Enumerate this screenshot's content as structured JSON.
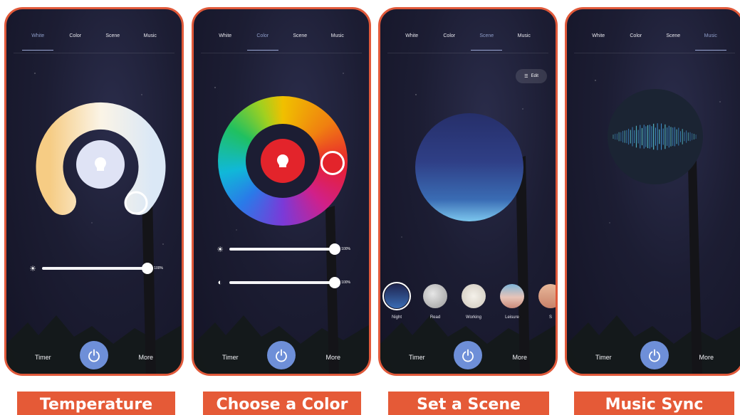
{
  "tabs": [
    "White",
    "Color",
    "Scene",
    "Music"
  ],
  "screens": [
    {
      "active_tab": 0,
      "tab_labels": [
        "White",
        "Color",
        "Scene",
        "Music"
      ],
      "timer": "Timer",
      "more": "More"
    },
    {
      "active_tab": 1,
      "tab_labels": [
        "White",
        "Color",
        "Scene",
        "Music"
      ],
      "timer": "Timer",
      "more": "More"
    },
    {
      "active_tab": 2,
      "tab_labels": [
        "White",
        "Color",
        "Scene",
        "Music"
      ],
      "timer": "Timer",
      "more": "More"
    },
    {
      "active_tab": 3,
      "tab_labels": [
        "White",
        "Color",
        "Scene",
        "Music"
      ],
      "timer": "Timer",
      "more": "More"
    }
  ],
  "white": {
    "brightness_label": "100%",
    "brightness": 1.0
  },
  "color": {
    "brightness_label": "100%",
    "saturation_label": "100%",
    "brightness": 1.0,
    "saturation": 1.0,
    "selected_color": "#e3242b"
  },
  "scene": {
    "edit_label": "Edit",
    "scenes": [
      {
        "label": "Night",
        "selected": true
      },
      {
        "label": "Read",
        "selected": false
      },
      {
        "label": "Working",
        "selected": false
      },
      {
        "label": "Leisure",
        "selected": false
      },
      {
        "label": "S",
        "selected": false
      }
    ]
  },
  "captions": [
    "Temperature",
    "Choose a Color",
    "Set a Scene",
    "Music Sync"
  ],
  "colors": {
    "accent": "#e55a37",
    "power": "#6e8fd8",
    "active_tab": "#8f9ec9"
  }
}
